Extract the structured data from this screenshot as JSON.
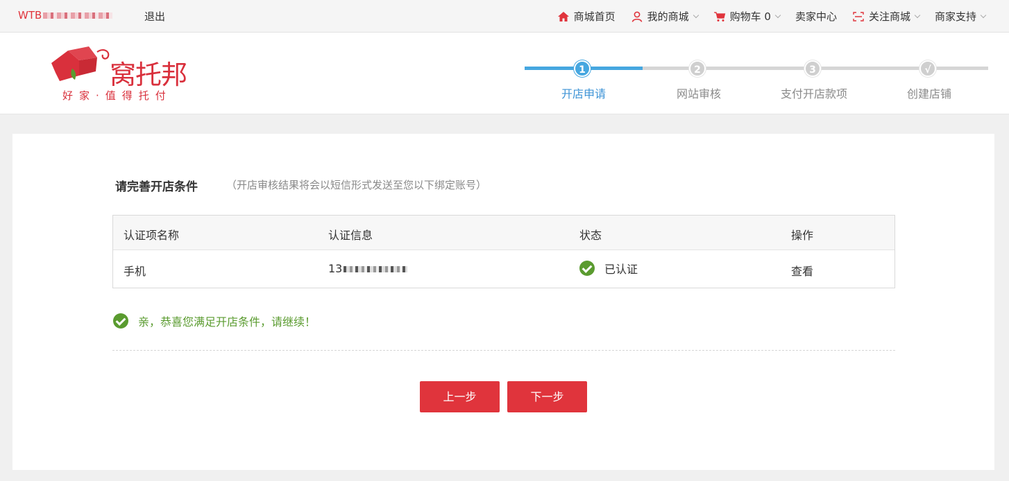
{
  "topbar": {
    "user_prefix": "WTB",
    "logout": "退出",
    "nav": [
      {
        "label": "商城首页",
        "icon": "home-icon",
        "caret": false
      },
      {
        "label": "我的商城",
        "icon": "user-icon",
        "caret": true
      },
      {
        "label": "购物车 0",
        "icon": "cart-icon",
        "caret": true
      },
      {
        "label": "卖家中心",
        "icon": "",
        "caret": false
      },
      {
        "label": "关注商城",
        "icon": "bookmark-icon",
        "caret": true
      },
      {
        "label": "商家支持",
        "icon": "",
        "caret": true
      }
    ]
  },
  "logo": {
    "brand": "窝托邦",
    "slogan": "好家·值得托付"
  },
  "steps": [
    {
      "num": "1",
      "label": "开店申请",
      "active": true
    },
    {
      "num": "2",
      "label": "网站审核",
      "active": false
    },
    {
      "num": "3",
      "label": "支付开店款项",
      "active": false
    },
    {
      "num": "√",
      "label": "创建店铺",
      "active": false
    }
  ],
  "main": {
    "title": "请完善开店条件",
    "subtitle": "（开店审核结果将会以短信形式发送至您以下绑定账号）",
    "table": {
      "headers": [
        "认证项名称",
        "认证信息",
        "状态",
        "操作"
      ],
      "row": {
        "name": "手机",
        "info_prefix": "13",
        "status": "已认证",
        "action": "查看"
      }
    },
    "success_msg": "亲，恭喜您满足开店条件，请继续！",
    "prev_button": "上一步",
    "next_button": "下一步"
  },
  "colors": {
    "brand_red": "#e0343c",
    "step_blue": "#46a7e0",
    "success_green": "#5a9b2f",
    "link_blue": "#2f73c4"
  }
}
